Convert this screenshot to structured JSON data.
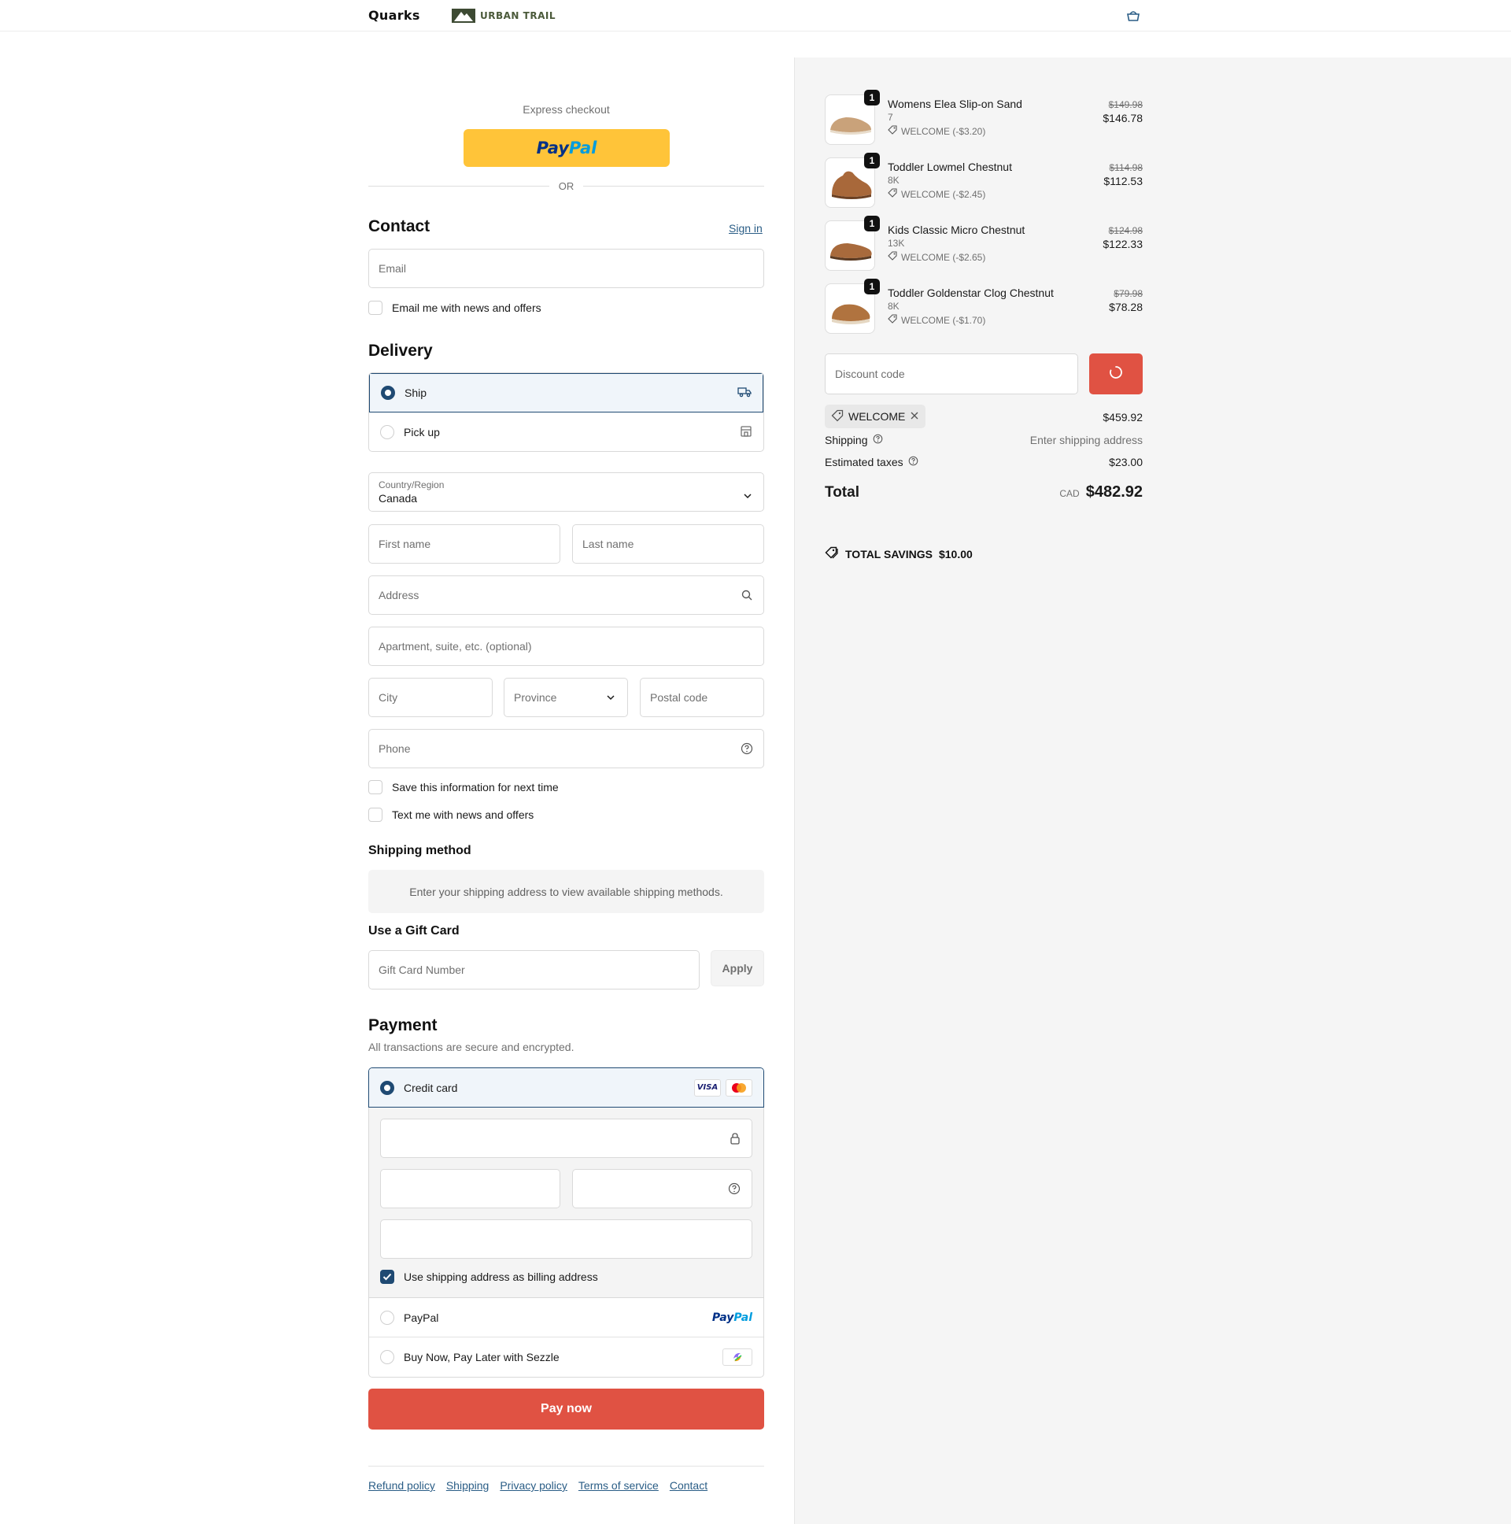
{
  "header": {
    "brand_primary": "Quarks",
    "brand_secondary": "URBAN TRAIL",
    "cart_icon": "cart-icon"
  },
  "express": {
    "label": "Express checkout",
    "paypal_a": "Pay",
    "paypal_b": "Pal",
    "or": "OR"
  },
  "contact": {
    "title": "Contact",
    "sign_in": "Sign in",
    "email_placeholder": "Email",
    "news_label": "Email me with news and offers"
  },
  "delivery": {
    "title": "Delivery",
    "options": [
      {
        "label": "Ship",
        "selected": true,
        "icon": "truck-icon"
      },
      {
        "label": "Pick up",
        "selected": false,
        "icon": "store-icon"
      }
    ],
    "country_label": "Country/Region",
    "country_value": "Canada",
    "first_name": "First name",
    "last_name": "Last name",
    "address": "Address",
    "apartment": "Apartment, suite, etc. (optional)",
    "city": "City",
    "province": "Province",
    "postal": "Postal code",
    "phone": "Phone",
    "save_info": "Save this information for next time",
    "text_me": "Text me with news and offers"
  },
  "shipping_method": {
    "title": "Shipping method",
    "info": "Enter your shipping address to view available shipping methods."
  },
  "gift_card": {
    "title": "Use a Gift Card",
    "placeholder": "Gift Card Number",
    "apply": "Apply"
  },
  "payment": {
    "title": "Payment",
    "subtitle": "All transactions are secure and encrypted.",
    "credit_card": "Credit card",
    "visa": "VISA",
    "billing_label": "Use shipping address as billing address",
    "paypal": "PayPal",
    "sezzle": "Buy Now, Pay Later with Sezzle",
    "pay_now": "Pay now"
  },
  "footer": {
    "links": [
      "Refund policy",
      "Shipping",
      "Privacy policy",
      "Terms of service",
      "Contact"
    ]
  },
  "summary": {
    "items": [
      {
        "name": "Womens Elea Slip-on Sand",
        "variant": "7",
        "discount": "WELCOME (-$3.20)",
        "old_price": "$149.98",
        "price": "$146.78",
        "qty": "1",
        "color": "#c9a27a"
      },
      {
        "name": "Toddler Lowmel Chestnut",
        "variant": "8K",
        "discount": "WELCOME (-$2.45)",
        "old_price": "$114.98",
        "price": "$112.53",
        "qty": "1",
        "color": "#a8683a"
      },
      {
        "name": "Kids Classic Micro Chestnut",
        "variant": "13K",
        "discount": "WELCOME (-$2.65)",
        "old_price": "$124.98",
        "price": "$122.33",
        "qty": "1",
        "color": "#a86a3c"
      },
      {
        "name": "Toddler Goldenstar Clog Chestnut",
        "variant": "8K",
        "discount": "WELCOME (-$1.70)",
        "old_price": "$79.98",
        "price": "$78.28",
        "qty": "1",
        "color": "#b0733f"
      }
    ],
    "discount_placeholder": "Discount code",
    "applied_code": "WELCOME",
    "subtotal": "$459.92",
    "shipping_label": "Shipping",
    "shipping_value": "Enter shipping address",
    "taxes_label": "Estimated taxes",
    "taxes_value": "$23.00",
    "total_label": "Total",
    "currency": "CAD",
    "total": "$482.92",
    "savings_label": "TOTAL SAVINGS",
    "savings_value": "$10.00"
  },
  "colors": {
    "accent": "#e05243",
    "primary": "#1f4a73",
    "paypal_yellow": "#ffc439"
  }
}
